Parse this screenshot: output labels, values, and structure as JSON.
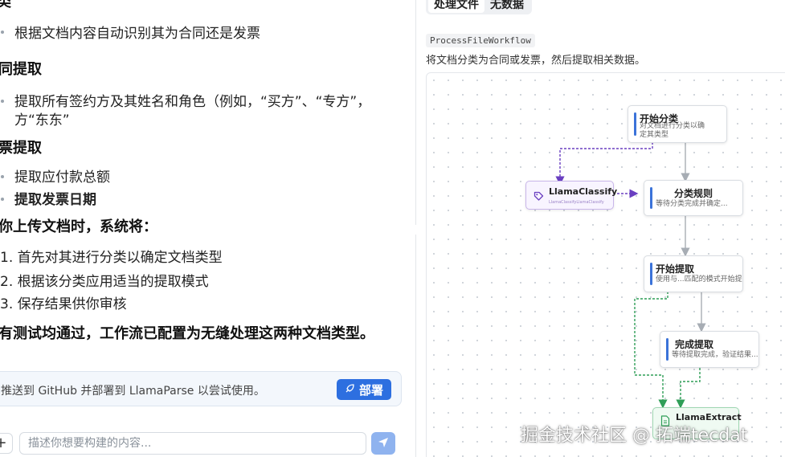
{
  "chat": {
    "heading_top": "类",
    "bullet_classify": "根据文档内容自动识别其为合同还是发票",
    "heading_contract": "同提取",
    "bullet_contract_1": "提取所有签约方及其姓名和角色（例如，“买方”、“专方”，",
    "bullet_contract_2": "方“东东”",
    "heading_invoice": "票提取",
    "bullet_invoice_1": "提取应付款总额",
    "bullet_invoice_2": "提取发票日期",
    "heading_upload": "你上传文档时，系统将：",
    "steps": [
      "1. 首先对其进行分类以确定文档类型",
      "2. 根据该分类应用适当的提取模式",
      "3. 保存结果供你审核"
    ],
    "conclusion": "有测试均通过，工作流已配置为无缝处理这两种文档类型。",
    "banner_text": "推送到 GitHub 并部署到 LlamaParse 以尝试使用。",
    "deploy_label": "部署",
    "plus_label": "+",
    "input_placeholder": "描述你想要构建的内容..."
  },
  "workflow": {
    "tabs": [
      "处理文件",
      "无数据"
    ],
    "name": "ProcessFileWorkflow",
    "description": "将文档分类为合同或发票，然后提取相关数据。",
    "nodes": {
      "start_classify": {
        "title": "开始分类",
        "sub1": "对文档进行分类以确",
        "sub2": "定其类型"
      },
      "llama_classify": {
        "title": "LlamaClassify",
        "sub": "LlamaClassifyLlamaClassify"
      },
      "classify_rules": {
        "title": "分类规则",
        "sub": "等待分类完成并确定..."
      },
      "start_extract": {
        "title": "开始提取",
        "sub": "使用与...匹配的模式开始提"
      },
      "finish_extract": {
        "title": "完成提取",
        "sub": "等待提取完成，验证结果..."
      },
      "llama_extract": {
        "title": "LlamaExtract"
      }
    }
  },
  "watermark": "掘金技术社区 @ 拓端tecdat",
  "colors": {
    "accent": "#2d6fe0",
    "node_bar": "#3b73d9",
    "classify_edge": "#6a3fc1",
    "extract_edge": "#2f9e57"
  }
}
